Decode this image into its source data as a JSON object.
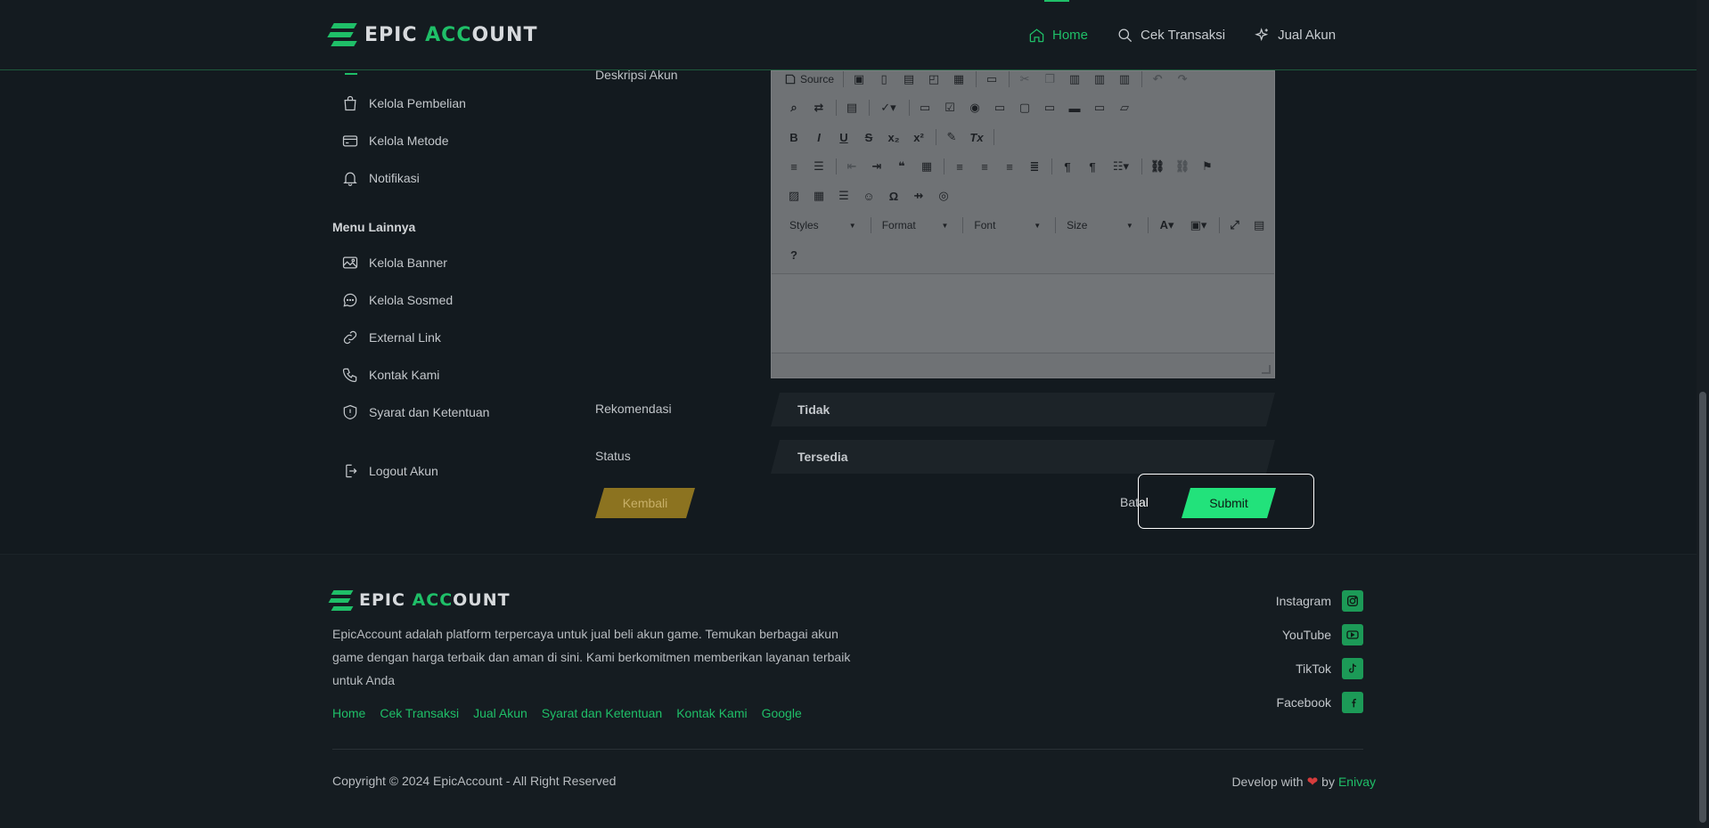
{
  "header": {
    "logo": {
      "part1": "EPIC ",
      "part2": "ACC",
      "part3": "OUNT"
    },
    "nav": [
      {
        "label": "Home",
        "icon": "home-icon",
        "active": true
      },
      {
        "label": "Cek Transaksi",
        "icon": "search-icon"
      },
      {
        "label": "Jual Akun",
        "icon": "sparkle-icon"
      }
    ]
  },
  "sidebar": {
    "items": [
      {
        "label": "Kelola Pembelian",
        "icon": "shopping-bag-icon"
      },
      {
        "label": "Kelola Metode",
        "icon": "credit-card-icon"
      },
      {
        "label": "Notifikasi",
        "icon": "bell-icon"
      }
    ],
    "heading": "Menu Lainnya",
    "items2": [
      {
        "label": "Kelola Banner",
        "icon": "image-icon"
      },
      {
        "label": "Kelola Sosmed",
        "icon": "chat-icon"
      },
      {
        "label": "External Link",
        "icon": "link-icon"
      },
      {
        "label": "Kontak Kami",
        "icon": "phone-icon"
      },
      {
        "label": "Syarat dan Ketentuan",
        "icon": "shield-icon"
      }
    ],
    "logout": "Logout Akun"
  },
  "form": {
    "deskripsi_label": "Deskripsi Akun",
    "editor": {
      "source_label": "Source",
      "styles": "Styles",
      "format": "Format",
      "font": "Font",
      "size": "Size"
    },
    "rekomendasi_label": "Rekomendasi",
    "rekomendasi_value": "Tidak",
    "status_label": "Status",
    "status_value": "Tersedia",
    "kembali": "Kembali",
    "batal_1": "Bat",
    "batal_2": "al",
    "submit": "Submit"
  },
  "footer": {
    "logo": {
      "part1": "EPIC ",
      "part2": "ACC",
      "part3": "OUNT"
    },
    "description": "EpicAccount adalah platform terpercaya untuk jual beli akun game. Temukan berbagai akun game dengan harga terbaik dan aman di sini. Kami berkomitmen memberikan layanan terbaik untuk Anda",
    "links": [
      "Home",
      "Cek Transaksi",
      "Jual Akun",
      "Syarat dan Ketentuan",
      "Kontak Kami",
      "Google"
    ],
    "social": [
      "Instagram",
      "YouTube",
      "TikTok",
      "Facebook"
    ],
    "copyright": "Copyright © 2024 EpicAccount - All Right Reserved",
    "develop_prefix": "Develop with",
    "develop_by": "by",
    "develop_author": "Enivay"
  },
  "colors": {
    "accent": "#1fbf68",
    "submit": "#22e27b",
    "kembali": "#8c7320",
    "background": "#131a1f"
  }
}
